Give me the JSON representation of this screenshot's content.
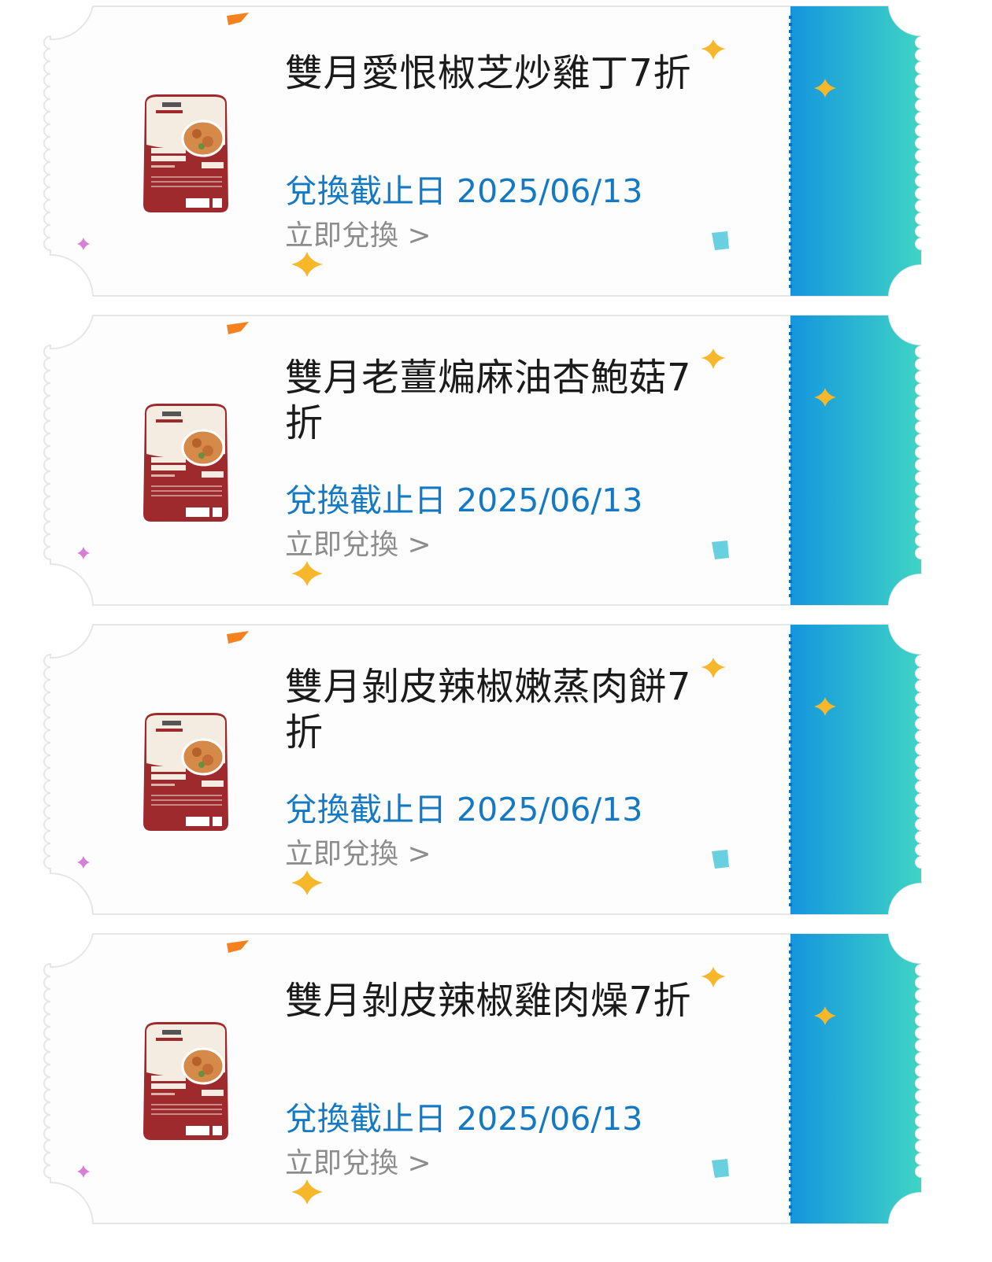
{
  "colors": {
    "title": "#1b1b1b",
    "expiry": "#1479c4",
    "redeem": "#8c8c8c",
    "stub_gradient_start": "#1495de",
    "stub_gradient_end": "#3fd4c4",
    "product_red": "#9e2a2e"
  },
  "coupons": [
    {
      "title": "雙月愛恨椒芝炒雞丁7折",
      "expiry": "兌換截止日 2025/06/13",
      "redeem": "立即兌換 >",
      "product_image": "meal-box-chicken-icon"
    },
    {
      "title": "雙月老薑煸麻油杏鮑菇7折",
      "expiry": "兌換截止日 2025/06/13",
      "redeem": "立即兌換 >",
      "product_image": "meal-box-mushroom-icon"
    },
    {
      "title": "雙月剝皮辣椒嫩蒸肉餅7折",
      "expiry": "兌換截止日 2025/06/13",
      "redeem": "立即兌換 >",
      "product_image": "meal-box-meat-patty-icon"
    },
    {
      "title": "雙月剝皮辣椒雞肉燥7折",
      "expiry": "兌換截止日 2025/06/13",
      "redeem": "立即兌換 >",
      "product_image": "meal-box-chicken-mince-icon"
    }
  ]
}
